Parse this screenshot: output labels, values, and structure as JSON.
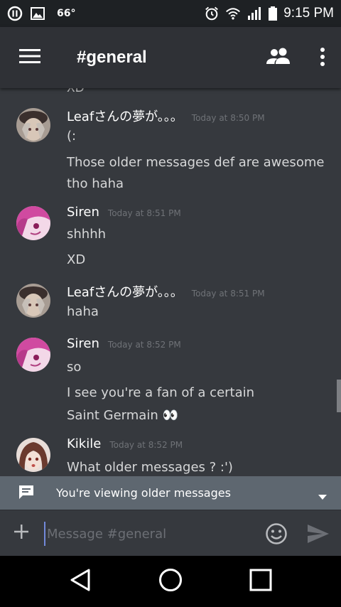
{
  "status_bar": {
    "temperature": "66°",
    "time": "9:15 PM"
  },
  "app_bar": {
    "channel_title": "#general"
  },
  "messages_area": {
    "cut_off_text": "XD",
    "groups": [
      {
        "author": "Leafさんの夢が。。。",
        "timestamp": "Today at 8:50 PM",
        "lines": [
          "(:",
          "Those older messages def are awesome",
          "tho haha"
        ]
      },
      {
        "author": "Siren",
        "timestamp": "Today at 8:51 PM",
        "lines": [
          "shhhh",
          "XD"
        ]
      },
      {
        "author": "Leafさんの夢が。。。",
        "timestamp": "Today at 8:51 PM",
        "lines": [
          "haha"
        ]
      },
      {
        "author": "Siren",
        "timestamp": "Today at 8:52 PM",
        "lines": [
          "so",
          "I see you're a fan of a certain",
          "Saint Germain 👀"
        ]
      },
      {
        "author": "Kikile",
        "timestamp": "Today at 8:52 PM",
        "lines": [
          "What older messages ? :')"
        ]
      }
    ]
  },
  "older_banner": {
    "text": "You're viewing older messages"
  },
  "input_bar": {
    "placeholder": "Message #general"
  },
  "colors": {
    "accent": "#7289da",
    "background": "#36393e",
    "app_bar": "#2f3136"
  }
}
